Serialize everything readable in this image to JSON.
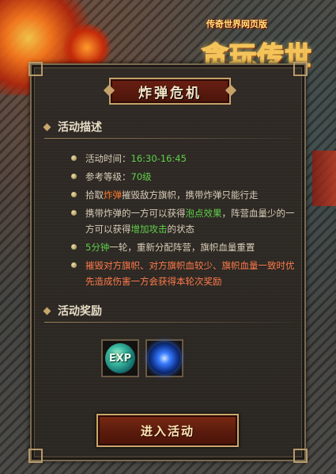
{
  "branding": {
    "sub_title": "传奇世界网页版",
    "main_title": "贪玩传世"
  },
  "panel": {
    "title": "炸弹危机",
    "description_heading": "活动描述",
    "items": [
      {
        "label": "活动时间：",
        "value": "16:30-16:45"
      },
      {
        "label": "参考等级：",
        "value": "70级"
      },
      {
        "pre": "拾取",
        "hl": "炸弹",
        "post": "摧毁敌方旗帜，携带炸弹只能行走"
      },
      {
        "pre": "携带炸弹的一方可以获得",
        "hl": "泡点效果",
        "mid": "，阵营血量少的一方可以获得",
        "hl2": "增加攻击",
        "post": "的状态"
      },
      {
        "hl": "5分钟",
        "post": "一轮，重新分配阵营，旗帜血量重置"
      },
      {
        "text": "摧毁对方旗帜、对方旗帜血较少、旗帜血量一致时优先造成伤害一方会获得本轮次奖励"
      }
    ],
    "reward_heading": "活动奖励",
    "rewards": [
      {
        "icon": "exp-orb-icon",
        "label": "EXP"
      },
      {
        "icon": "blue-orb-icon"
      }
    ],
    "enter_button": "进入活动"
  },
  "colors": {
    "green_highlight": "#5fd04a",
    "orange_highlight": "#ff7a2e",
    "title_plate": "#6a1f12",
    "gold_border": "#c6a26a"
  }
}
